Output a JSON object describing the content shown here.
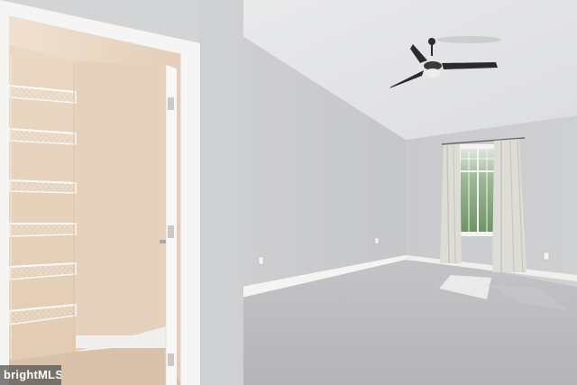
{
  "watermark": {
    "text": "brightMLS"
  },
  "colors": {
    "wall": "#cfd0d2",
    "ceiling": "#e6e7e8",
    "carpet": "#bfbfc2",
    "closet_wall": "#e8d6c3",
    "trim": "#f4f4f2",
    "fan": "#2b2b2d",
    "window_glass": "#8fae86"
  },
  "icons": [
    "ceiling-fan-icon",
    "wire-shelf-icon",
    "door-hinge-icon",
    "outlet-icon"
  ]
}
